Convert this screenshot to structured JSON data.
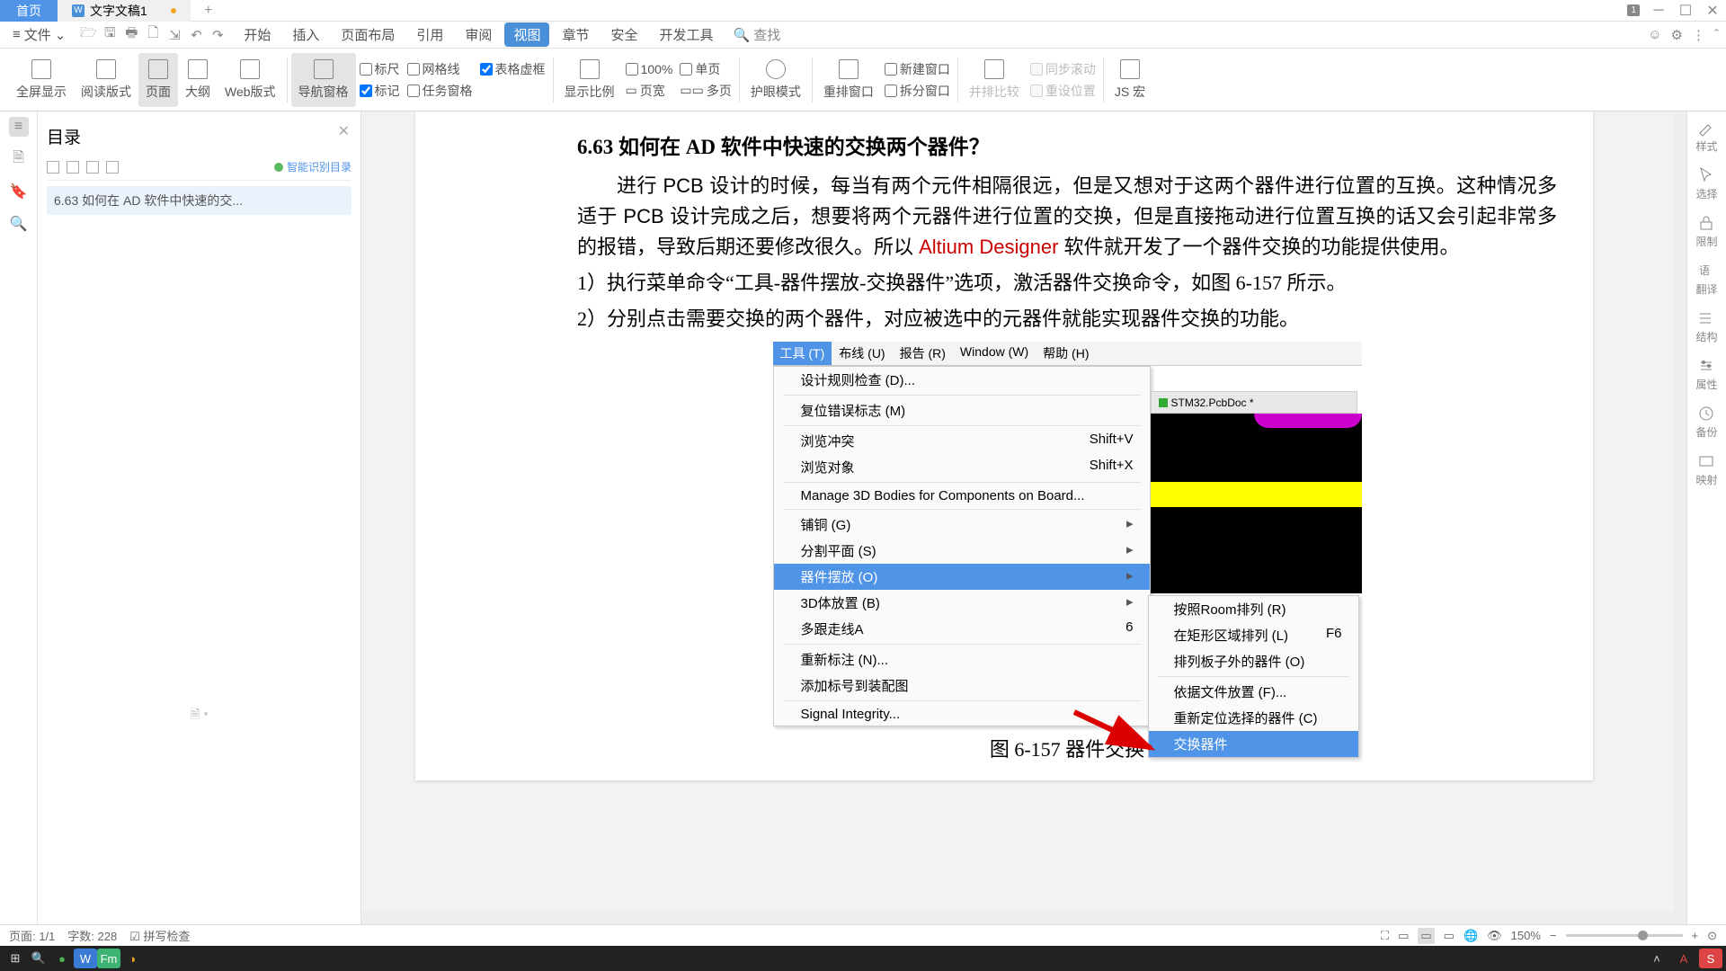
{
  "tabs": {
    "home": "首页",
    "doc": "文字文稿1"
  },
  "menus": {
    "file": "文件",
    "start": "开始",
    "insert": "插入",
    "pagelayout": "页面布局",
    "ref": "引用",
    "review": "审阅",
    "view": "视图",
    "chapter": "章节",
    "security": "安全",
    "devtools": "开发工具",
    "search": "查找"
  },
  "ribbon": {
    "fullscreen": "全屏显示",
    "readmode": "阅读版式",
    "page": "页面",
    "outline": "大纲",
    "webview": "Web版式",
    "navgrid": "导航窗格",
    "ruler": "标尺",
    "grid": "网格线",
    "taskpane": "任务窗格",
    "mark": "标记",
    "virtual": "表格虚框",
    "ratio": "显示比例",
    "onehundred": "100%",
    "pagew": "页宽",
    "onepage": "单页",
    "multipage": "多页",
    "eyecare": "护眼模式",
    "rearrange": "重排窗口",
    "newwin": "新建窗口",
    "splitwin": "拆分窗口",
    "compare": "并排比较",
    "syncscroll": "同步滚动",
    "resetpos": "重设位置",
    "jsmacro": "JS 宏"
  },
  "toc": {
    "title": "目录",
    "smart": "智能识别目录",
    "entry": "6.63   如何在 AD 软件中快速的交...",
    "full_entry": "6.63   如何在 AD 软件中快速的交换两个器件？"
  },
  "doc": {
    "heading": "6.63   如何在 AD 软件中快速的交换两个器件？",
    "p1": "进行 PCB 设计的时候，每当有两个元件相隔很远，但是又想对于这两个器件进行位置的互换。这种情况多适于 PCB 设计完成之后，想要将两个元器件进行位置的交换，但是直接拖动进行位置互换的话又会引起非常多的报错，导致后期还要修改很久。所以 ",
    "p1r": "Altium Designer",
    "p1b": " 软件就开发了一个器件交换的功能提供使用。",
    "p2": "1）执行菜单命令“工具-器件摆放-交换器件”选项，激活器件交换命令，如图 6-157 所示。",
    "p3": "2）分别点击需要交换的两个器件，对应被选中的元器件就能实现器件交换的功能。",
    "caption": "图 6-157  器件交换"
  },
  "ad": {
    "menus": {
      "tools": "工具 (T)",
      "route": "布线 (U)",
      "report": "报告 (R)",
      "window": "Window (W)",
      "help": "帮助 (H)"
    },
    "items": {
      "drc": "设计规则检查 (D)...",
      "reseterr": "复位错误标志 (M)",
      "browseconf": "浏览冲突",
      "browseobj": "浏览对象",
      "manage3d": "Manage 3D Bodies for Components on Board...",
      "copper": "铺铜 (G)",
      "split": "分割平面 (S)",
      "placement": "器件摆放 (O)",
      "body3d": "3D体放置 (B)",
      "multi": "多跟走线A",
      "reanno": "重新标注 (N)...",
      "adddes": "添加标号到装配图",
      "si": "Signal Integrity...",
      "sc_v": "Shift+V",
      "sc_x": "Shift+X",
      "six": "6"
    },
    "sub": {
      "room": "按照Room排列 (R)",
      "rect": "在矩形区域排列 (L)",
      "f6": "F6",
      "outside": "排列板子外的器件 (O)",
      "byfile": "依据文件放置 (F)...",
      "relocate": "重新定位选择的器件 (C)",
      "swap": "交换器件"
    },
    "tab": "STM32.PcbDoc *"
  },
  "right": {
    "style": "样式",
    "select": "选择",
    "limit": "限制",
    "translate": "翻译",
    "structure": "结构",
    "property": "属性",
    "backup": "备份",
    "mapping": "映射"
  },
  "status": {
    "page": "页面: 1/1",
    "words": "字数: 228",
    "spell": "拼写检查",
    "zoom": "150%"
  }
}
